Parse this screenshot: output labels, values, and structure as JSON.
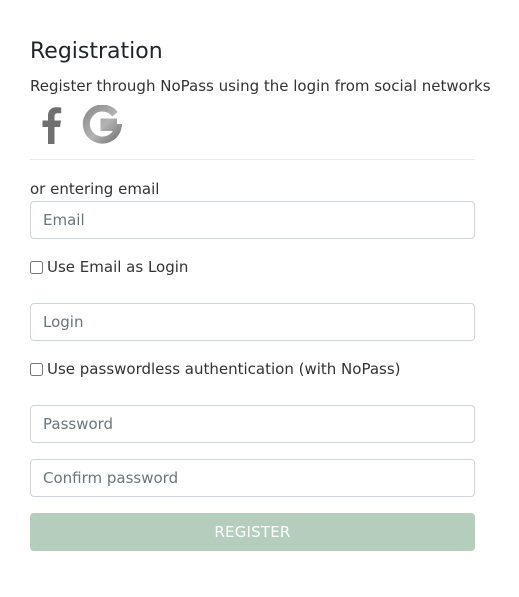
{
  "form": {
    "title": "Registration",
    "subtitle": "Register through NoPass using the login from social networks",
    "social_icons": [
      "facebook-icon",
      "google-icon"
    ],
    "or_label": "or entering email",
    "email": {
      "placeholder": "Email",
      "value": ""
    },
    "use_email_as_login": {
      "label": "Use Email as Login",
      "checked": false
    },
    "login": {
      "placeholder": "Login",
      "value": ""
    },
    "passwordless": {
      "label": "Use passwordless authentication (with NoPass)",
      "checked": false
    },
    "password": {
      "placeholder": "Password",
      "value": ""
    },
    "confirm_password": {
      "placeholder": "Confirm password",
      "value": ""
    },
    "register_label": "REGISTER",
    "colors": {
      "button_bg": "#b5cdbd",
      "icon_gray": "#707070"
    }
  }
}
